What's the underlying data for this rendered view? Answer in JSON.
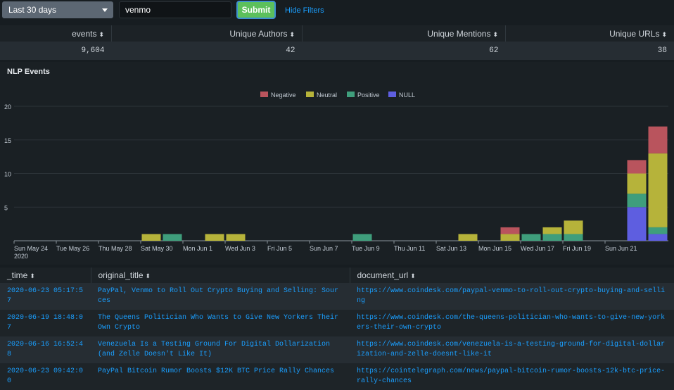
{
  "filters": {
    "time_range": "Last 30 days",
    "search_value": "venmo",
    "submit_label": "Submit",
    "hide_filters_label": "Hide Filters"
  },
  "stats": {
    "headers": [
      "events",
      "Unique Authors",
      "Unique Mentions",
      "Unique URLs"
    ],
    "values": [
      "9,604",
      "42",
      "62",
      "38"
    ]
  },
  "chart_title": "NLP Events",
  "chart_data": {
    "type": "bar",
    "stacked": true,
    "title": "NLP Events",
    "legend_position": "top-center",
    "ylim": [
      0,
      20
    ],
    "yticks": [
      5,
      10,
      15,
      20
    ],
    "xtick_labels": [
      "Sun May 24",
      "Tue May 26",
      "Thu May 28",
      "Sat May 30",
      "Mon Jun 1",
      "Wed Jun 3",
      "Fri Jun 5",
      "Sun Jun 7",
      "Tue Jun 9",
      "Thu Jun 11",
      "Sat Jun 13",
      "Mon Jun 15",
      "Wed Jun 17",
      "Fri Jun 19",
      "Sun Jun 21"
    ],
    "x_first_year": "2020",
    "categories": [
      "May 24",
      "May 25",
      "May 26",
      "May 27",
      "May 28",
      "May 29",
      "May 30",
      "May 31",
      "Jun 1",
      "Jun 2",
      "Jun 3",
      "Jun 4",
      "Jun 5",
      "Jun 6",
      "Jun 7",
      "Jun 8",
      "Jun 9",
      "Jun 10",
      "Jun 11",
      "Jun 12",
      "Jun 13",
      "Jun 14",
      "Jun 15",
      "Jun 16",
      "Jun 17",
      "Jun 18",
      "Jun 19",
      "Jun 20",
      "Jun 21",
      "Jun 22",
      "Jun 23"
    ],
    "series": [
      {
        "name": "Negative",
        "color": "#b9545d",
        "values": [
          0,
          0,
          0,
          0,
          0,
          0,
          0,
          0,
          0,
          0,
          0,
          0,
          0,
          0,
          0,
          0,
          0,
          0,
          0,
          0,
          0,
          0,
          0,
          1,
          0,
          0,
          0,
          0,
          0,
          2,
          4
        ]
      },
      {
        "name": "Neutral",
        "color": "#b6b33a",
        "values": [
          0,
          0,
          0,
          0,
          0,
          0,
          1,
          0,
          0,
          1,
          1,
          0,
          0,
          0,
          0,
          0,
          0,
          0,
          0,
          0,
          0,
          1,
          0,
          1,
          0,
          1,
          2,
          0,
          0,
          3,
          11
        ]
      },
      {
        "name": "Positive",
        "color": "#3f9e7c",
        "values": [
          0,
          0,
          0,
          0,
          0,
          0,
          0,
          1,
          0,
          0,
          0,
          0,
          0,
          0,
          0,
          0,
          1,
          0,
          0,
          0,
          0,
          0,
          0,
          0,
          1,
          1,
          1,
          0,
          0,
          2,
          1
        ]
      },
      {
        "name": "NULL",
        "color": "#5e5ee0",
        "values": [
          0,
          0,
          0,
          0,
          0,
          0,
          0,
          0,
          0,
          0,
          0,
          0,
          0,
          0,
          0,
          0,
          0,
          0,
          0,
          0,
          0,
          0,
          0,
          0,
          0,
          0,
          0,
          0,
          0,
          5,
          1
        ]
      }
    ]
  },
  "events": {
    "headers": [
      "_time",
      "original_title",
      "document_url"
    ],
    "rows": [
      {
        "time": "2020-06-23 05:17:57",
        "title": "PayPal, Venmo to Roll Out Crypto Buying and Selling: Sources",
        "url": "https://www.coindesk.com/paypal-venmo-to-roll-out-crypto-buying-and-selling"
      },
      {
        "time": "2020-06-19 18:48:07",
        "title": "The Queens Politician Who Wants to Give New Yorkers Their Own Crypto",
        "url": "https://www.coindesk.com/the-queens-politician-who-wants-to-give-new-yorkers-their-own-crypto"
      },
      {
        "time": "2020-06-16 16:52:48",
        "title": "Venezuela Is a Testing Ground For Digital Dollarization (and Zelle Doesn't Like It)",
        "url": "https://www.coindesk.com/venezuela-is-a-testing-ground-for-digital-dollarization-and-zelle-doesnt-like-it"
      },
      {
        "time": "2020-06-23 09:42:00",
        "title": "PayPal Bitcoin Rumor Boosts $12K BTC Price Rally Chances",
        "url": "https://cointelegraph.com/news/paypal-bitcoin-rumor-boosts-12k-btc-price-rally-chances"
      }
    ]
  }
}
